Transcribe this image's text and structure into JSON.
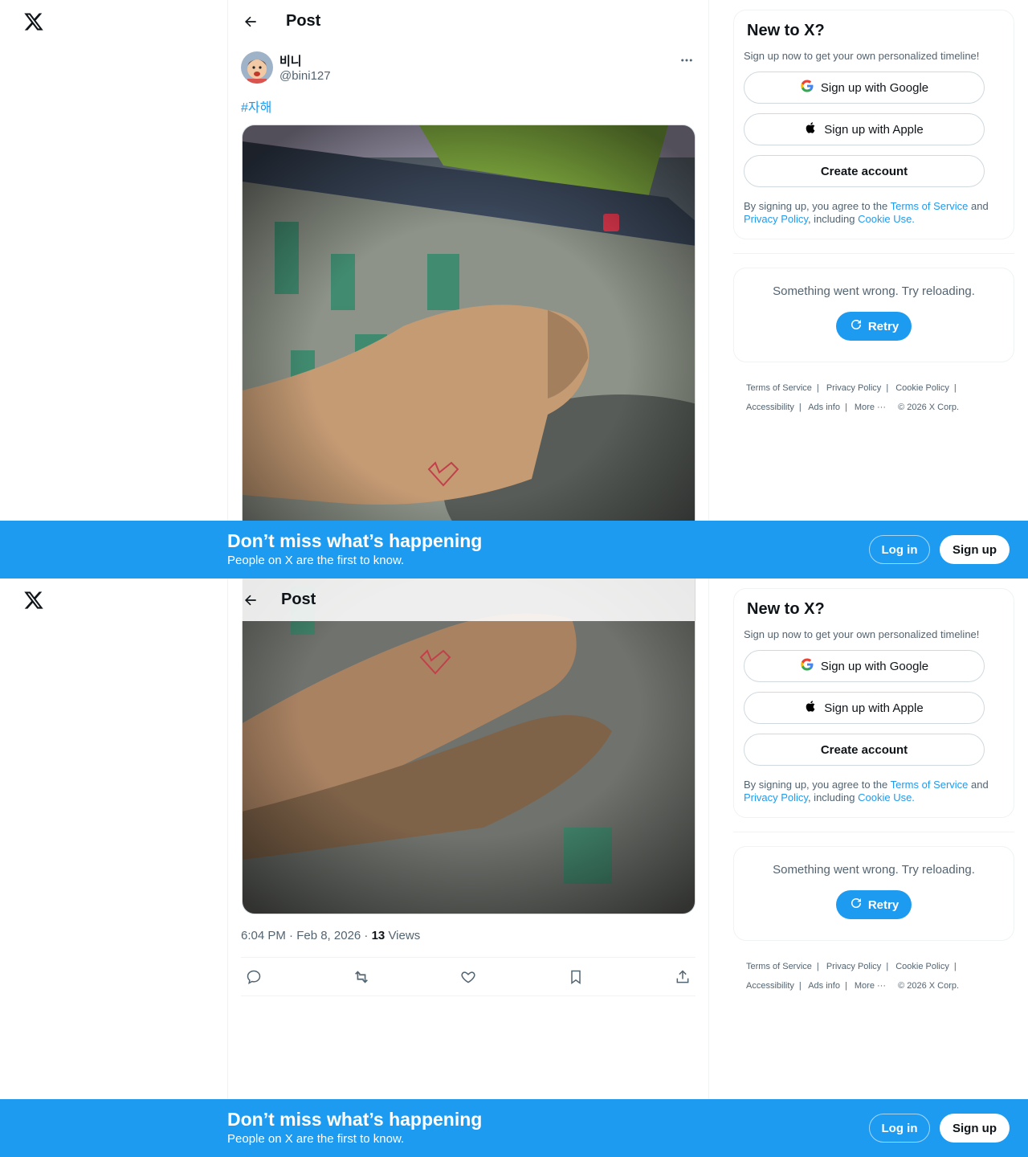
{
  "header": {
    "title": "Post"
  },
  "author": {
    "name": "비니",
    "handle": "@bini127"
  },
  "post": {
    "hashtag": "#자해",
    "timestamp": "6:04 PM · Feb 8, 2026 · ",
    "views_count": "13",
    "views_label": " Views"
  },
  "actions": [
    "reply-icon",
    "repost-icon",
    "like-icon",
    "bookmark-icon",
    "share-icon"
  ],
  "signup_card": {
    "title": "New to X?",
    "subtitle": "Sign up now to get your own personalized timeline!",
    "google_label": "Sign up with Google",
    "apple_label": "Sign up with Apple",
    "create_label": "Create account",
    "terms_prefix": "By signing up, you agree to the ",
    "terms_link": "Terms of Service",
    "terms_and": " and ",
    "privacy_link": "Privacy Policy",
    "terms_including": ", including ",
    "cookie_link": "Cookie Use."
  },
  "error_card": {
    "message": "Something went wrong. Try reloading.",
    "retry_label": "Retry"
  },
  "footer": {
    "terms": "Terms of Service",
    "privacy": "Privacy Policy",
    "cookie": "Cookie Policy",
    "accessibility": "Accessibility",
    "ads": "Ads info",
    "more": "More ···",
    "copyright": "© 2026 X Corp."
  },
  "banner": {
    "headline": "Don’t miss what’s happening",
    "subline": "People on X are the first to know.",
    "login_label": "Log in",
    "signup_label": "Sign up"
  },
  "colors": {
    "accent": "#1d9bf0",
    "text": "#0f1419",
    "muted": "#536471"
  }
}
